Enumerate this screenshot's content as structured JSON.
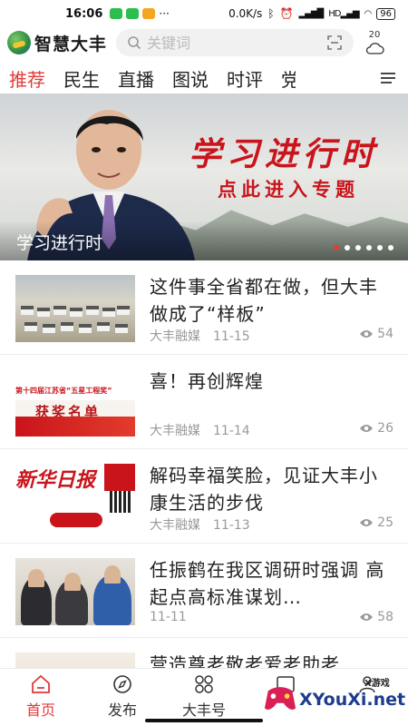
{
  "status_bar": {
    "time": "16:06",
    "network_speed": "0.0K/s",
    "battery": "96"
  },
  "header": {
    "app_name": "智慧大丰",
    "search_placeholder": "关键词",
    "temperature": "20"
  },
  "tabs": [
    {
      "label": "推荐",
      "active": true
    },
    {
      "label": "民生"
    },
    {
      "label": "直播"
    },
    {
      "label": "图说"
    },
    {
      "label": "时评"
    },
    {
      "label": "党"
    }
  ],
  "banner": {
    "title": "学习进行时",
    "subtitle": "点此进入专题",
    "caption": "学习进行时",
    "slide_count": 6,
    "active_slide": 1
  },
  "news": [
    {
      "title": "这件事全省都在做，但大丰做成了“样板”",
      "source": "大丰融媒",
      "date": "11-15",
      "views": "54"
    },
    {
      "title": "喜！再创辉煌",
      "source": "大丰融媒",
      "date": "11-14",
      "views": "26",
      "thumb_text": "第十四届江苏省“五星工程奖”",
      "thumb_award": "获奖名单"
    },
    {
      "title": "解码幸福笑脸，见证大丰小康生活的步伐",
      "source": "大丰融媒",
      "date": "11-13",
      "views": "25",
      "thumb_text": "新华日报"
    },
    {
      "title": "任振鹤在我区调研时强调 高起点高标准谋划…",
      "source": "",
      "date": "11-11",
      "views": "58"
    },
    {
      "title": "营造尊老敬老爱老助老",
      "source": "",
      "date": "",
      "views": ""
    }
  ],
  "bottom_nav": [
    {
      "label": "首页",
      "icon": "home-icon",
      "active": true
    },
    {
      "label": "发布",
      "icon": "compass-icon"
    },
    {
      "label": "大丰号",
      "icon": "grid-icon"
    },
    {
      "label": "",
      "icon": "video-icon"
    },
    {
      "label": "",
      "icon": "user-icon"
    }
  ],
  "watermark": {
    "site": "XYouXi.net",
    "tag": "X游戏"
  },
  "colors": {
    "accent": "#e03a3a",
    "banner_red": "#c9141b"
  }
}
